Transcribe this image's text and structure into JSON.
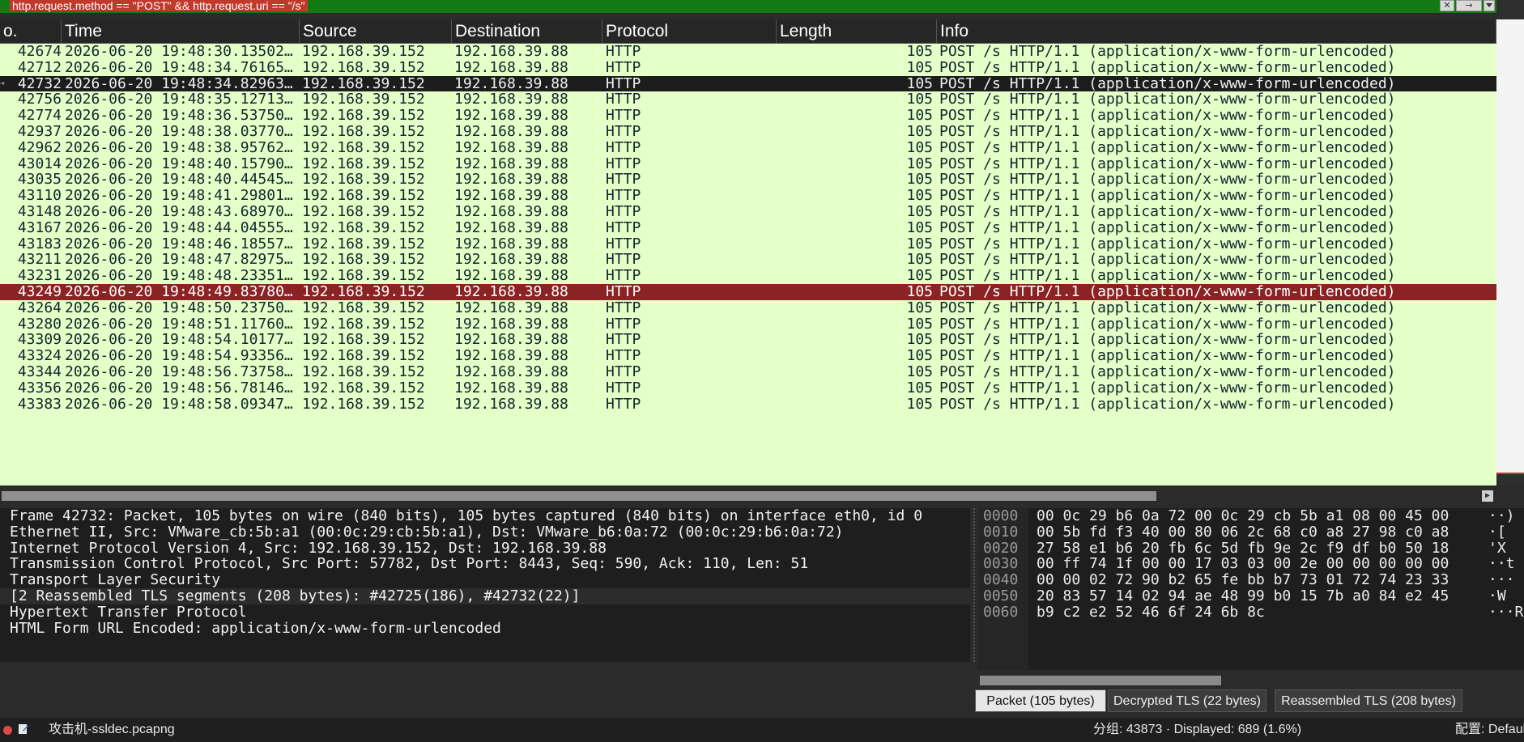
{
  "filter": {
    "expression": "http.request.method == \"POST\" && http.request.uri == \"/s\"",
    "clear_glyph": "✕",
    "apply_glyph": "→"
  },
  "columns": [
    "o.",
    "Time",
    "Source",
    "Destination",
    "Protocol",
    "Length",
    "Info"
  ],
  "packets": [
    {
      "no": "42674",
      "time": "2026-06-20 19:48:30.13502…",
      "src": "192.168.39.152",
      "dst": "192.168.39.88",
      "proto": "HTTP",
      "len": "105",
      "info": "POST /s HTTP/1.1  (application/x-www-form-urlencoded)",
      "state": "normal"
    },
    {
      "no": "42712",
      "time": "2026-06-20 19:48:34.76165…",
      "src": "192.168.39.152",
      "dst": "192.168.39.88",
      "proto": "HTTP",
      "len": "105",
      "info": "POST /s HTTP/1.1  (application/x-www-form-urlencoded)",
      "state": "normal"
    },
    {
      "no": "42732",
      "time": "2026-06-20 19:48:34.82963…",
      "src": "192.168.39.152",
      "dst": "192.168.39.88",
      "proto": "HTTP",
      "len": "105",
      "info": "POST /s HTTP/1.1  (application/x-www-form-urlencoded)",
      "state": "selected"
    },
    {
      "no": "42756",
      "time": "2026-06-20 19:48:35.12713…",
      "src": "192.168.39.152",
      "dst": "192.168.39.88",
      "proto": "HTTP",
      "len": "105",
      "info": "POST /s HTTP/1.1  (application/x-www-form-urlencoded)",
      "state": "normal"
    },
    {
      "no": "42774",
      "time": "2026-06-20 19:48:36.53750…",
      "src": "192.168.39.152",
      "dst": "192.168.39.88",
      "proto": "HTTP",
      "len": "105",
      "info": "POST /s HTTP/1.1  (application/x-www-form-urlencoded)",
      "state": "normal"
    },
    {
      "no": "42937",
      "time": "2026-06-20 19:48:38.03770…",
      "src": "192.168.39.152",
      "dst": "192.168.39.88",
      "proto": "HTTP",
      "len": "105",
      "info": "POST /s HTTP/1.1  (application/x-www-form-urlencoded)",
      "state": "normal"
    },
    {
      "no": "42962",
      "time": "2026-06-20 19:48:38.95762…",
      "src": "192.168.39.152",
      "dst": "192.168.39.88",
      "proto": "HTTP",
      "len": "105",
      "info": "POST /s HTTP/1.1  (application/x-www-form-urlencoded)",
      "state": "normal"
    },
    {
      "no": "43014",
      "time": "2026-06-20 19:48:40.15790…",
      "src": "192.168.39.152",
      "dst": "192.168.39.88",
      "proto": "HTTP",
      "len": "105",
      "info": "POST /s HTTP/1.1  (application/x-www-form-urlencoded)",
      "state": "normal"
    },
    {
      "no": "43035",
      "time": "2026-06-20 19:48:40.44545…",
      "src": "192.168.39.152",
      "dst": "192.168.39.88",
      "proto": "HTTP",
      "len": "105",
      "info": "POST /s HTTP/1.1  (application/x-www-form-urlencoded)",
      "state": "normal"
    },
    {
      "no": "43110",
      "time": "2026-06-20 19:48:41.29801…",
      "src": "192.168.39.152",
      "dst": "192.168.39.88",
      "proto": "HTTP",
      "len": "105",
      "info": "POST /s HTTP/1.1  (application/x-www-form-urlencoded)",
      "state": "normal"
    },
    {
      "no": "43148",
      "time": "2026-06-20 19:48:43.68970…",
      "src": "192.168.39.152",
      "dst": "192.168.39.88",
      "proto": "HTTP",
      "len": "105",
      "info": "POST /s HTTP/1.1  (application/x-www-form-urlencoded)",
      "state": "normal"
    },
    {
      "no": "43167",
      "time": "2026-06-20 19:48:44.04555…",
      "src": "192.168.39.152",
      "dst": "192.168.39.88",
      "proto": "HTTP",
      "len": "105",
      "info": "POST /s HTTP/1.1  (application/x-www-form-urlencoded)",
      "state": "normal"
    },
    {
      "no": "43183",
      "time": "2026-06-20 19:48:46.18557…",
      "src": "192.168.39.152",
      "dst": "192.168.39.88",
      "proto": "HTTP",
      "len": "105",
      "info": "POST /s HTTP/1.1  (application/x-www-form-urlencoded)",
      "state": "normal"
    },
    {
      "no": "43211",
      "time": "2026-06-20 19:48:47.82975…",
      "src": "192.168.39.152",
      "dst": "192.168.39.88",
      "proto": "HTTP",
      "len": "105",
      "info": "POST /s HTTP/1.1  (application/x-www-form-urlencoded)",
      "state": "normal"
    },
    {
      "no": "43231",
      "time": "2026-06-20 19:48:48.23351…",
      "src": "192.168.39.152",
      "dst": "192.168.39.88",
      "proto": "HTTP",
      "len": "105",
      "info": "POST /s HTTP/1.1  (application/x-www-form-urlencoded)",
      "state": "normal"
    },
    {
      "no": "43249",
      "time": "2026-06-20 19:48:49.83780…",
      "src": "192.168.39.152",
      "dst": "192.168.39.88",
      "proto": "HTTP",
      "len": "105",
      "info": "POST /s HTTP/1.1  (application/x-www-form-urlencoded)",
      "state": "marked"
    },
    {
      "no": "43264",
      "time": "2026-06-20 19:48:50.23750…",
      "src": "192.168.39.152",
      "dst": "192.168.39.88",
      "proto": "HTTP",
      "len": "105",
      "info": "POST /s HTTP/1.1  (application/x-www-form-urlencoded)",
      "state": "normal"
    },
    {
      "no": "43280",
      "time": "2026-06-20 19:48:51.11760…",
      "src": "192.168.39.152",
      "dst": "192.168.39.88",
      "proto": "HTTP",
      "len": "105",
      "info": "POST /s HTTP/1.1  (application/x-www-form-urlencoded)",
      "state": "normal"
    },
    {
      "no": "43309",
      "time": "2026-06-20 19:48:54.10177…",
      "src": "192.168.39.152",
      "dst": "192.168.39.88",
      "proto": "HTTP",
      "len": "105",
      "info": "POST /s HTTP/1.1  (application/x-www-form-urlencoded)",
      "state": "normal"
    },
    {
      "no": "43324",
      "time": "2026-06-20 19:48:54.93356…",
      "src": "192.168.39.152",
      "dst": "192.168.39.88",
      "proto": "HTTP",
      "len": "105",
      "info": "POST /s HTTP/1.1  (application/x-www-form-urlencoded)",
      "state": "normal"
    },
    {
      "no": "43344",
      "time": "2026-06-20 19:48:56.73758…",
      "src": "192.168.39.152",
      "dst": "192.168.39.88",
      "proto": "HTTP",
      "len": "105",
      "info": "POST /s HTTP/1.1  (application/x-www-form-urlencoded)",
      "state": "normal"
    },
    {
      "no": "43356",
      "time": "2026-06-20 19:48:56.78146…",
      "src": "192.168.39.152",
      "dst": "192.168.39.88",
      "proto": "HTTP",
      "len": "105",
      "info": "POST /s HTTP/1.1  (application/x-www-form-urlencoded)",
      "state": "normal"
    },
    {
      "no": "43383",
      "time": "2026-06-20 19:48:58.09347…",
      "src": "192.168.39.152",
      "dst": "192.168.39.88",
      "proto": "HTTP",
      "len": "105",
      "info": "POST /s HTTP/1.1  (application/x-www-form-urlencoded)",
      "state": "normal"
    }
  ],
  "details": [
    "Frame 42732: Packet, 105 bytes on wire (840 bits), 105 bytes captured (840 bits) on interface eth0, id 0",
    "Ethernet II, Src: VMware_cb:5b:a1 (00:0c:29:cb:5b:a1), Dst: VMware_b6:0a:72 (00:0c:29:b6:0a:72)",
    "Internet Protocol Version 4, Src: 192.168.39.152, Dst: 192.168.39.88",
    "Transmission Control Protocol, Src Port: 57782, Dst Port: 8443, Seq: 590, Ack: 110, Len: 51",
    "Transport Layer Security",
    "[2 Reassembled TLS segments (208 bytes): #42725(186), #42732(22)]",
    "Hypertext Transfer Protocol",
    "HTML Form URL Encoded: application/x-www-form-urlencoded"
  ],
  "hex": [
    {
      "offset": "0000",
      "bytes": "00 0c 29 b6 0a 72 00 0c  29 cb 5b a1 08 00 45 00",
      "ascii": "··)"
    },
    {
      "offset": "0010",
      "bytes": "00 5b fd f3 40 00 80 06  2c 68 c0 a8 27 98 c0 a8",
      "ascii": "·["
    },
    {
      "offset": "0020",
      "bytes": "27 58 e1 b6 20 fb 6c 5d  fb 9e 2c f9 df b0 50 18",
      "ascii": "'X"
    },
    {
      "offset": "0030",
      "bytes": "00 ff 74 1f 00 00 17 03  03 00 2e 00 00 00 00 00",
      "ascii": "··t"
    },
    {
      "offset": "0040",
      "bytes": "00 00 02 72 90 b2 65 fe  bb b7 73 01 72 74 23 33",
      "ascii": "···"
    },
    {
      "offset": "0050",
      "bytes": "20 83 57 14 02 94 ae 48  99 b0 15 7b a0 84 e2 45",
      "ascii": " ·W"
    },
    {
      "offset": "0060",
      "bytes": "b9 c2 e2 52 46 6f 24 6b  8c",
      "ascii": "···R"
    }
  ],
  "tabs": [
    "Packet (105 bytes)",
    "Decrypted TLS (22 bytes)",
    "Reassembled TLS (208 bytes)"
  ],
  "status": {
    "file": "攻击机-ssldec.pcapng",
    "stats": "分组: 43873 · Displayed: 689 (1.6%)",
    "profile": "配置: Default"
  },
  "colors": {
    "filter_ok": "#137a13",
    "row_bg": "#e4ffc7",
    "row_selected": "#1d1d1d",
    "row_marked": "#8a2323"
  }
}
